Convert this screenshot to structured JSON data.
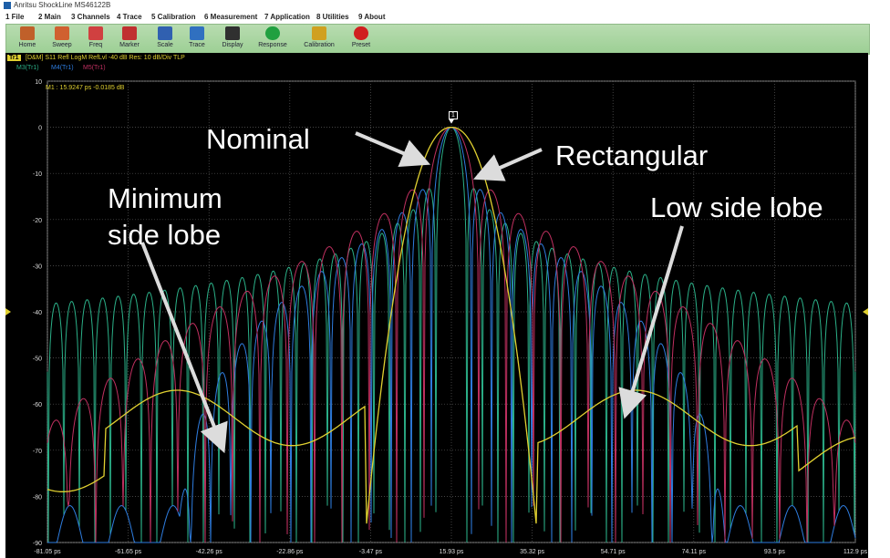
{
  "window": {
    "title": "Anritsu ShockLine MS46122B"
  },
  "menu": [
    "1 File",
    "2 Main",
    "3 Channels",
    "4 Trace",
    "5 Calibration",
    "6 Measurement",
    "7 Application",
    "8 Utilities",
    "9 About"
  ],
  "toolbar": [
    {
      "label": "Home",
      "icon": "home-icon",
      "color": "#c0602a"
    },
    {
      "label": "Sweep",
      "icon": "sweep-icon",
      "color": "#d06030"
    },
    {
      "label": "Freq",
      "icon": "freq-icon",
      "color": "#d04040"
    },
    {
      "label": "Marker",
      "icon": "marker-icon",
      "color": "#c03030"
    },
    {
      "label": "Scale",
      "icon": "scale-icon",
      "color": "#3060b0"
    },
    {
      "label": "Trace",
      "icon": "trace-icon",
      "color": "#3070c0"
    },
    {
      "label": "Display",
      "icon": "display-icon",
      "color": "#303030"
    },
    {
      "label": "Response",
      "icon": "response-icon",
      "color": "#20a040"
    },
    {
      "label": "Calibration",
      "icon": "calibration-icon",
      "color": "#d0a020"
    },
    {
      "label": "Preset",
      "icon": "preset-icon",
      "color": "#d02020"
    }
  ],
  "trace_header": {
    "tab": "Tr1",
    "text": "[D&M] S11 Refl LogM RefLvl -40 dB Res: 10 dB/Div TLP",
    "memories": [
      "M3(Tr1)",
      "M4(Tr1)",
      "M5(Tr1)"
    ]
  },
  "marker_readout": "M1 : 15.9247 ps  -0.0185 dB",
  "marker_flag": "1",
  "colors": {
    "yellow": "#e0d030",
    "green": "#2bb088",
    "blue": "#2e7de0",
    "magenta": "#c03060",
    "grid": "#5a5a5a"
  },
  "annotations": {
    "nominal": "Nominal",
    "rectangular": "Rectangular",
    "minimum_line1": "Minimum",
    "minimum_line2": "side lobe",
    "low_side_lobe": "Low side lobe"
  },
  "chart_data": {
    "type": "line",
    "title": "",
    "xlabel": "",
    "ylabel": "",
    "ylim": [
      -90,
      10
    ],
    "yticks": [
      10,
      0,
      -10,
      -20,
      -30,
      -40,
      -50,
      -60,
      -70,
      -80,
      -90
    ],
    "xticks": [
      "-81.05 ps",
      "-61.65 ps",
      "-42.26 ps",
      "-22.86 ps",
      "-3.47 ps",
      "15.93 ps",
      "35.32 ps",
      "54.71 ps",
      "74.11 ps",
      "93.5 ps",
      "112.9 ps"
    ],
    "ref_level": -40,
    "series": [
      {
        "name": "M3(Tr1)",
        "color": "#2bb088",
        "approx_peak_db": 0,
        "sidelobe_floor_db": -35
      },
      {
        "name": "M4(Tr1)",
        "color": "#2e7de0",
        "approx_peak_db": 0,
        "sidelobe_floor_db": -50
      },
      {
        "name": "M5(Tr1)",
        "color": "#c03060",
        "approx_peak_db": 0,
        "sidelobe_floor_db": -70
      },
      {
        "name": "Tr1",
        "color": "#e0d030",
        "approx_peak_db": 0,
        "sidelobe_floor_db": -68
      }
    ]
  }
}
